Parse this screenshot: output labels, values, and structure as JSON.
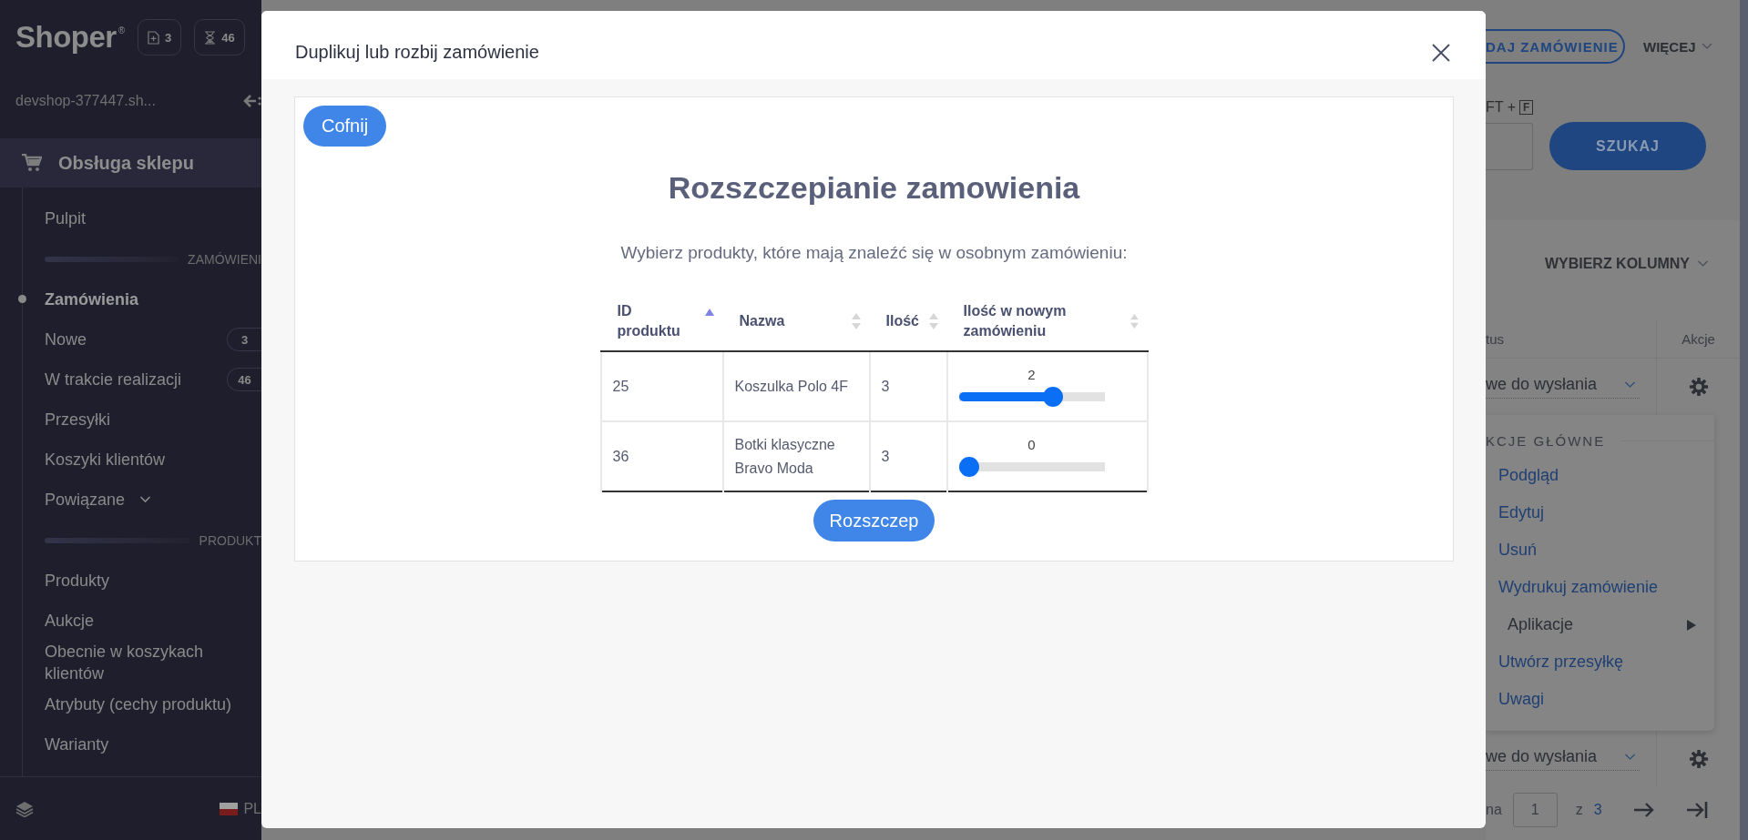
{
  "sidebar": {
    "logo": "Shoper",
    "logo_mark": "®",
    "counters": [
      {
        "kind": "new",
        "count": "3"
      },
      {
        "kind": "pending",
        "count": "46"
      }
    ],
    "shop": "devshop-377447.sh...",
    "section": "Obsługa sklepu",
    "items": [
      {
        "kind": "link",
        "label": "Pulpit",
        "selected": false
      },
      {
        "kind": "divider",
        "label": "ZAMÓWIENI"
      },
      {
        "kind": "link",
        "label": "Zamówienia",
        "selected": true
      },
      {
        "kind": "link",
        "label": "Nowe",
        "selected": false,
        "count": "3"
      },
      {
        "kind": "link",
        "label": "W trakcie realizacji",
        "selected": false,
        "count": "46"
      },
      {
        "kind": "link",
        "label": "Przesyłki",
        "selected": false
      },
      {
        "kind": "link",
        "label": "Koszyki klientów",
        "selected": false
      },
      {
        "kind": "group",
        "label": "Powiązane",
        "expanded": false
      },
      {
        "kind": "divider",
        "label": "PRODUKT"
      },
      {
        "kind": "link",
        "label": "Produkty",
        "selected": false
      },
      {
        "kind": "link",
        "label": "Aukcje",
        "selected": false
      },
      {
        "kind": "link",
        "label": "Obecnie w koszykach klientów",
        "selected": false
      },
      {
        "kind": "link",
        "label": "Atrybuty (cechy produktu)",
        "selected": false
      },
      {
        "kind": "link",
        "label": "Warianty",
        "selected": false
      }
    ],
    "language": "PL"
  },
  "toolbar": {
    "add_button": "DAJ ZAMÓWIENIE",
    "more_menu": "WIĘCEJ"
  },
  "search": {
    "shortcut": "FT +",
    "key": "F",
    "button": "SZUKAJ"
  },
  "orders": {
    "columns_button": "WYBIERZ KOLUMNY",
    "columns": [
      "tus",
      "Akcje"
    ],
    "rows": [
      {
        "status": "we do wysłania"
      },
      {
        "status": "we do wysłania"
      }
    ]
  },
  "action_menu": {
    "heading": "KCJE GŁÓWNE",
    "items": [
      {
        "kind": "action",
        "label": "Podgląd"
      },
      {
        "kind": "action",
        "label": "Edytuj"
      },
      {
        "kind": "action",
        "label": "Usuń"
      },
      {
        "kind": "action",
        "label": "Wydrukuj zamówienie"
      },
      {
        "kind": "submenu",
        "label": "Aplikacje"
      },
      {
        "kind": "action",
        "label": "Utwórz przesyłkę"
      },
      {
        "kind": "action",
        "label": "Uwagi"
      }
    ]
  },
  "pagination": {
    "label": "na",
    "page": "1",
    "of": "z",
    "total": "3"
  },
  "modal": {
    "title": "Duplikuj lub rozbij zamówienie",
    "back_button": "Cofnij",
    "heading": "Rozszczepianie zamowienia",
    "instruction": "Wybierz produkty, które mają znaleźć się w osobnym zamówieniu:",
    "table": {
      "columns": [
        {
          "label": "ID produktu",
          "sorted": true
        },
        {
          "label": "Nazwa",
          "sorted": false
        },
        {
          "label": "Ilość",
          "sorted": false
        },
        {
          "label": "Ilość w nowym zamówieniu",
          "sorted": false
        }
      ],
      "rows": [
        {
          "id": "25",
          "name": "Koszulka Polo 4F",
          "quantity": "3",
          "new_quantity": "2",
          "level": 0.667
        },
        {
          "id": "36",
          "name": "Botki klasyczne Bravo Moda",
          "quantity": "3",
          "new_quantity": "0",
          "level": 0
        }
      ]
    },
    "submit_button": "Rozszczep"
  }
}
